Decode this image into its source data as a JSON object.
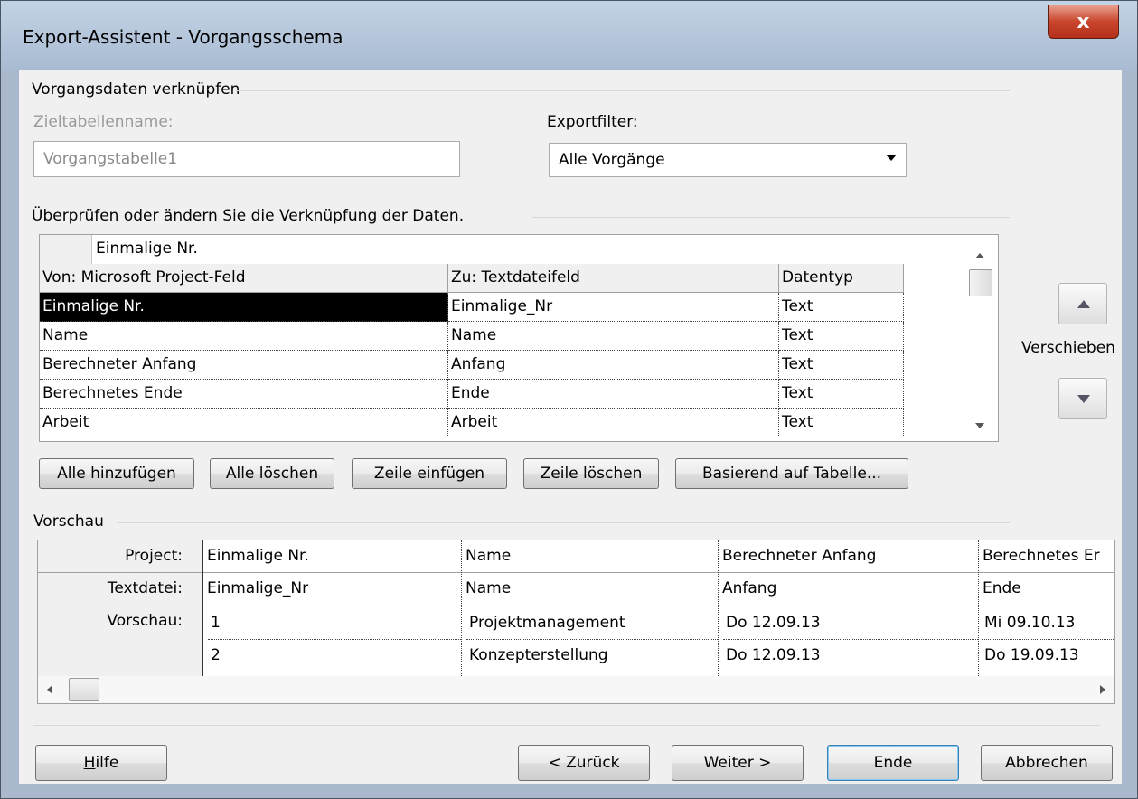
{
  "window": {
    "title": "Export-Assistent - Vorgangsschema",
    "close_label": "x"
  },
  "section": {
    "title": "Vorgangsdaten verknüpfen"
  },
  "target_table": {
    "label": "Zieltabellenname:",
    "value": "Vorgangstabelle1"
  },
  "export_filter": {
    "label": "Exportfilter:",
    "value": "Alle Vorgänge"
  },
  "mapping": {
    "instruction": "Überprüfen oder ändern Sie die Verknüpfung der Daten.",
    "edit_value": "Einmalige Nr.",
    "columns": [
      "Von: Microsoft Project-Feld",
      "Zu: Textdateifeld",
      "Datentyp"
    ],
    "rows": [
      {
        "from": "Einmalige Nr.",
        "to": "Einmalige_Nr",
        "type": "Text"
      },
      {
        "from": "Name",
        "to": "Name",
        "type": "Text"
      },
      {
        "from": "Berechneter Anfang",
        "to": "Anfang",
        "type": "Text"
      },
      {
        "from": "Berechnetes Ende",
        "to": "Ende",
        "type": "Text"
      },
      {
        "from": "Arbeit",
        "to": "Arbeit",
        "type": "Text"
      }
    ],
    "selected_row": 0,
    "move_label": "Verschieben"
  },
  "mapping_buttons": {
    "add_all": "Alle hinzufügen",
    "clear_all": "Alle löschen",
    "insert_row": "Zeile einfügen",
    "delete_row": "Zeile löschen",
    "based_on_table": "Basierend auf Tabelle..."
  },
  "preview": {
    "title": "Vorschau",
    "row_labels": {
      "project": "Project:",
      "textfile": "Textdatei:",
      "preview": "Vorschau:"
    },
    "project_fields": [
      "Einmalige Nr.",
      "Name",
      "Berechneter Anfang",
      "Berechnetes Er"
    ],
    "textfile_fields": [
      "Einmalige_Nr",
      "Name",
      "Anfang",
      "Ende"
    ],
    "rows": [
      [
        "1",
        "Projektmanagement",
        "Do 12.09.13",
        "Mi 09.10.13"
      ],
      [
        "2",
        "Konzepterstellung",
        "Do 12.09.13",
        "Do 19.09.13"
      ]
    ]
  },
  "footer": {
    "help": "Hilfe",
    "help_mnemonic": "H",
    "help_rest": "ilfe",
    "back": "< Zurück",
    "next": "Weiter >",
    "finish": "Ende",
    "cancel": "Abbrechen"
  }
}
